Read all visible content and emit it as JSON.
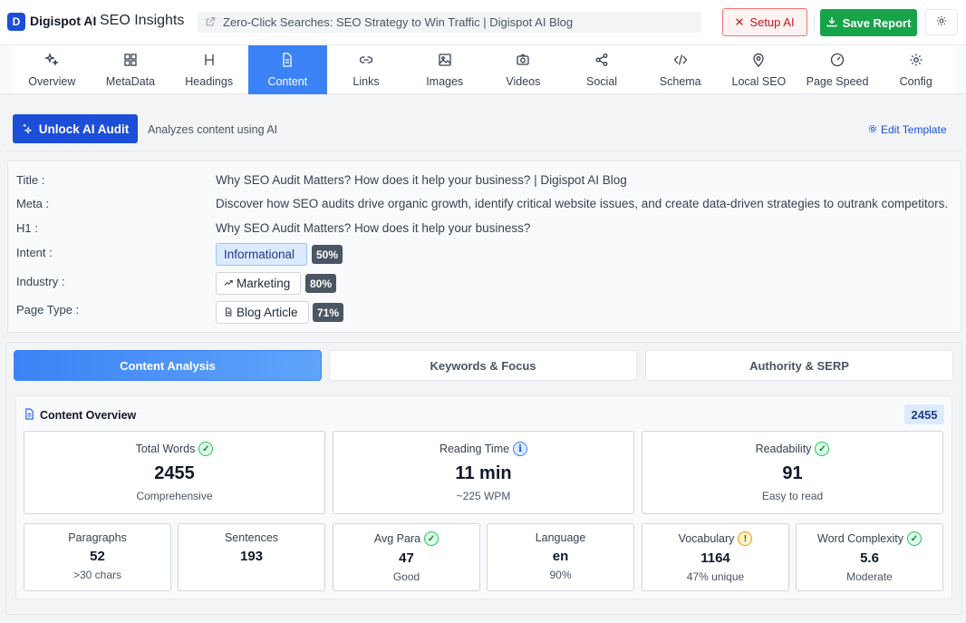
{
  "header": {
    "logo_letter": "D",
    "brand": "Digispot AI",
    "app_title": "SEO Insights",
    "url_text": "Zero-Click Searches: SEO Strategy to Win Traffic | Digispot AI Blog",
    "setup_label": "Setup AI",
    "save_label": "Save Report"
  },
  "tabs": [
    {
      "label": "Overview",
      "icon": "sparkles-icon"
    },
    {
      "label": "MetaData",
      "icon": "grid-icon"
    },
    {
      "label": "Headings",
      "icon": "heading-icon"
    },
    {
      "label": "Content",
      "icon": "document-icon",
      "active": true
    },
    {
      "label": "Links",
      "icon": "link-icon"
    },
    {
      "label": "Images",
      "icon": "image-icon"
    },
    {
      "label": "Videos",
      "icon": "camera-icon"
    },
    {
      "label": "Social",
      "icon": "share-icon"
    },
    {
      "label": "Schema",
      "icon": "code-icon"
    },
    {
      "label": "Local SEO",
      "icon": "location-pin-icon"
    },
    {
      "label": "Page Speed",
      "icon": "gauge-icon"
    },
    {
      "label": "Config",
      "icon": "gear-icon"
    }
  ],
  "audit": {
    "unlock_label": "Unlock AI Audit",
    "description": "Analyzes content using AI",
    "edit_template": "Edit Template"
  },
  "meta": {
    "title_label": "Title :",
    "title_value": "Why SEO Audit Matters? How does it help your business? | Digispot AI Blog",
    "meta_label": "Meta :",
    "meta_value": "Discover how SEO audits drive organic growth, identify critical website issues, and create data-driven strategies to outrank competitors.",
    "h1_label": "H1 :",
    "h1_value": "Why SEO Audit Matters? How does it help your business?",
    "intent_label": "Intent :",
    "intent_value": "Informational",
    "intent_pct": "50%",
    "industry_label": "Industry :",
    "industry_value": "Marketing",
    "industry_pct": "80%",
    "pagetype_label": "Page Type :",
    "pagetype_value": "Blog Article",
    "pagetype_pct": "71%"
  },
  "subtabs": [
    "Content Analysis",
    "Keywords & Focus",
    "Authority & SERP"
  ],
  "overview": {
    "title": "Content Overview",
    "count": "2455",
    "big_cards": [
      {
        "label": "Total Words",
        "value": "2455",
        "sub": "Comprehensive",
        "status": "ok"
      },
      {
        "label": "Reading Time",
        "value": "11 min",
        "sub": "~225 WPM",
        "status": "info"
      },
      {
        "label": "Readability",
        "value": "91",
        "sub": "Easy to read",
        "status": "ok"
      }
    ],
    "small_cards": [
      {
        "label": "Paragraphs",
        "value": "52",
        "sub": ">30 chars",
        "status": ""
      },
      {
        "label": "Sentences",
        "value": "193",
        "sub": "",
        "status": ""
      },
      {
        "label": "Avg Para",
        "value": "47",
        "sub": "Good",
        "status": "ok"
      },
      {
        "label": "Language",
        "value": "en",
        "sub": "90%",
        "status": ""
      },
      {
        "label": "Vocabulary",
        "value": "1164",
        "sub": "47% unique",
        "status": "warn"
      },
      {
        "label": "Word Complexity",
        "value": "5.6",
        "sub": "Moderate",
        "status": "ok"
      }
    ]
  }
}
